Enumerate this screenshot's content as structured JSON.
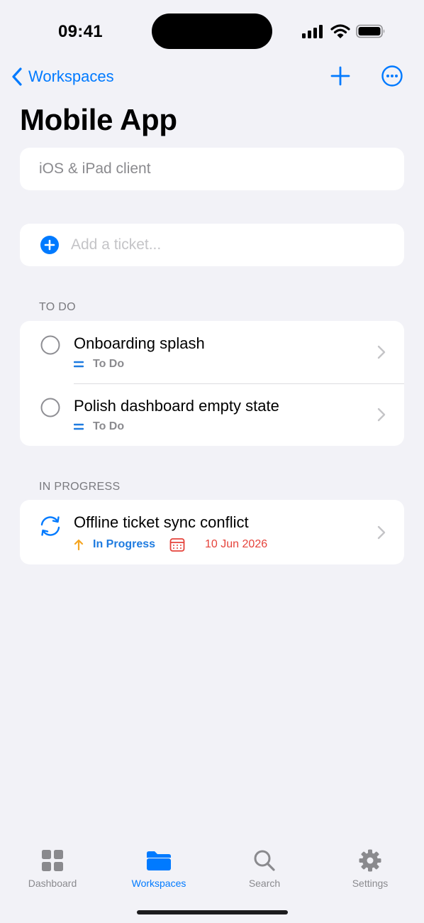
{
  "status_bar": {
    "time": "09:41"
  },
  "nav": {
    "back_label": "Workspaces",
    "title": "Mobile App"
  },
  "project": {
    "description": "iOS & iPad client"
  },
  "add_ticket": {
    "placeholder": "Add a ticket..."
  },
  "sections": [
    {
      "header": "TO DO",
      "tickets": [
        {
          "title": "Onboarding splash",
          "status": "To Do",
          "priority_icon": "equals-icon",
          "status_icon": "empty-circle-icon"
        },
        {
          "title": "Polish dashboard empty state",
          "status": "To Do",
          "priority_icon": "equals-icon",
          "status_icon": "empty-circle-icon"
        }
      ]
    },
    {
      "header": "IN PROGRESS",
      "tickets": [
        {
          "title": "Offline ticket sync conflict",
          "status": "In Progress",
          "priority_icon": "arrow-up-icon",
          "status_icon": "sync-icon",
          "due_date": "10 Jun 2026"
        }
      ]
    }
  ],
  "tab_bar": {
    "tabs": [
      {
        "label": "Dashboard",
        "icon": "grid-icon",
        "active": false
      },
      {
        "label": "Workspaces",
        "icon": "folder-icon",
        "active": true
      },
      {
        "label": "Search",
        "icon": "search-icon",
        "active": false
      },
      {
        "label": "Settings",
        "icon": "gear-icon",
        "active": false
      }
    ]
  },
  "colors": {
    "accent": "#007AFF",
    "background": "#F2F2F7",
    "priority_high": "#F5A623",
    "due_date": "#E5433B",
    "secondary_text": "#8A8A8E"
  }
}
